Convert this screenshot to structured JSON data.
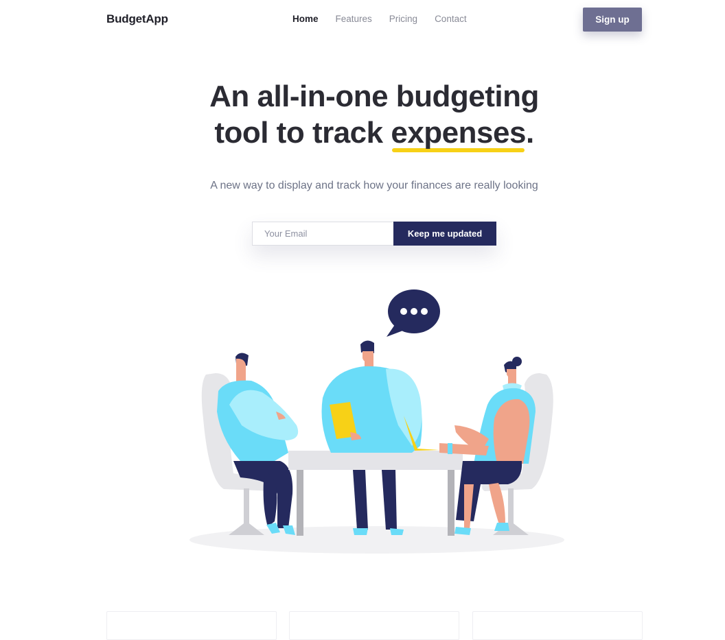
{
  "nav": {
    "brand": "BudgetApp",
    "links": [
      {
        "label": "Home",
        "active": true
      },
      {
        "label": "Features",
        "active": false
      },
      {
        "label": "Pricing",
        "active": false
      },
      {
        "label": "Contact",
        "active": false
      }
    ],
    "signup_label": "Sign up"
  },
  "hero": {
    "headline_line1": "An all-in-one budgeting",
    "headline_line2_pre": "tool to track ",
    "headline_highlight": "expenses",
    "headline_end": ".",
    "subtitle": "A new way to display and track how your finances are really looking"
  },
  "form": {
    "email_placeholder": "Your Email",
    "email_value": "",
    "cta_label": "Keep me updated"
  },
  "illustration": {
    "icon": "team-meeting-illustration",
    "speech_bubble_icon": "speech-bubble-ellipsis-icon"
  },
  "colors": {
    "accent_dark": "#252a5e",
    "signup_bg": "#6e6f92",
    "highlight_yellow": "#f7d117",
    "cyan": "#6adcf8"
  },
  "cards": [
    {},
    {},
    {}
  ]
}
